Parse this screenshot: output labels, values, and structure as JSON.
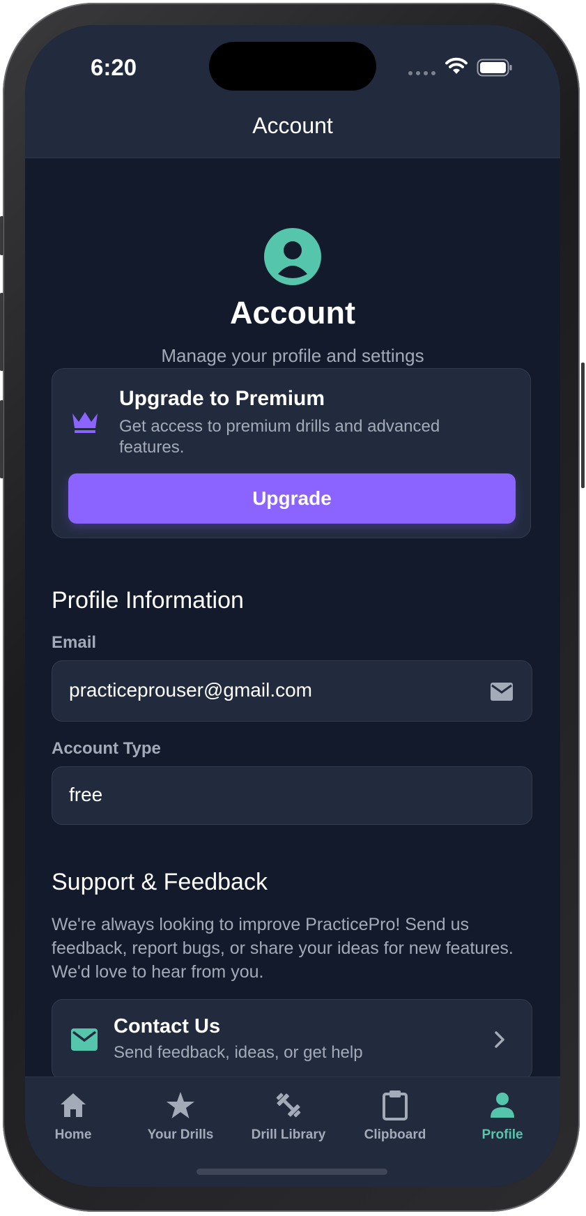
{
  "status_bar": {
    "time": "6:20"
  },
  "nav": {
    "title": "Account"
  },
  "hero": {
    "title": "Account",
    "subtitle": "Manage your profile and settings"
  },
  "premium": {
    "title": "Upgrade to Premium",
    "description": "Get access to premium drills and advanced features.",
    "button_label": "Upgrade"
  },
  "profile": {
    "section_title": "Profile Information",
    "email_label": "Email",
    "email_value": "practiceprouser@gmail.com",
    "account_type_label": "Account Type",
    "account_type_value": "free"
  },
  "support": {
    "section_title": "Support & Feedback",
    "description": "We're always looking to improve PracticePro! Send us feedback, report bugs, or share your ideas for new features. We'd love to hear from you.",
    "contact_title": "Contact Us",
    "contact_subtitle": "Send feedback, ideas, or get help"
  },
  "tabs": [
    {
      "label": "Home",
      "icon": "home-icon"
    },
    {
      "label": "Your Drills",
      "icon": "star-icon"
    },
    {
      "label": "Drill Library",
      "icon": "dumbbell-icon"
    },
    {
      "label": "Clipboard",
      "icon": "clipboard-icon"
    },
    {
      "label": "Profile",
      "icon": "person-icon",
      "active": true
    }
  ],
  "colors": {
    "background": "#131a2c",
    "surface": "#222b3e",
    "accent_purple": "#8b64ff",
    "accent_teal": "#55c5ac",
    "muted_text": "#a3aab8"
  }
}
